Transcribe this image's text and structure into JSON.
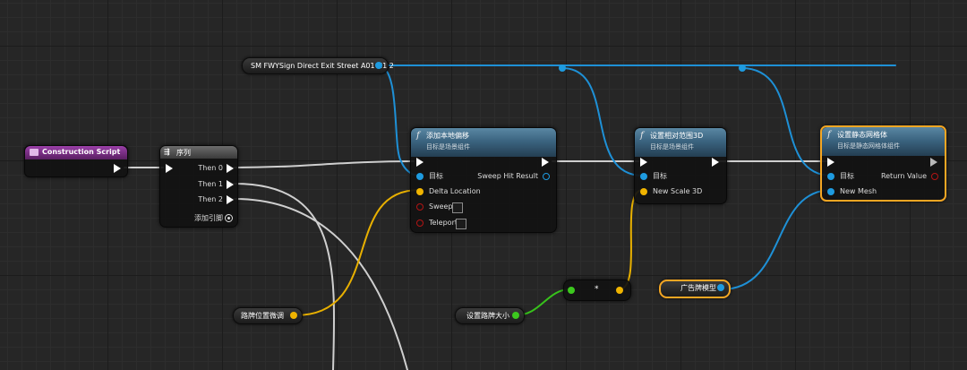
{
  "colors": {
    "exec": "#ffffff",
    "object": "#1e9be0",
    "vector": "#f0b400",
    "float": "#3cc81e",
    "struct": "#e8c020",
    "selection": "#f4a623",
    "function_header": "#3b6480",
    "event_header": "#7a2f86"
  },
  "variables": {
    "sm_mesh": "SM FWYSign Direct Exit Street A01 N1 2",
    "sign_offset": "路牌位置微调",
    "sign_size": "设置路牌大小",
    "billboard_model": "广告牌模型"
  },
  "construction_script": {
    "title": "Construction Script"
  },
  "sequence": {
    "title": "序列",
    "then0": "Then 0",
    "then1": "Then 1",
    "then2": "Then 2",
    "add_pin": "添加引脚"
  },
  "add_local_offset": {
    "title": "添加本地偏移",
    "subtitle": "目标是场景组件",
    "target": "目标",
    "delta": "Delta Location",
    "sweep": "Sweep",
    "teleport": "Teleport",
    "sweep_hit": "Sweep Hit Result"
  },
  "set_relative_scale": {
    "title": "设置相对范围3D",
    "subtitle": "目标是场景组件",
    "target": "目标",
    "new_scale": "New Scale 3D"
  },
  "set_static_mesh": {
    "title": "设置静态网格体",
    "subtitle": "目标是静态网格体组件",
    "target": "目标",
    "new_mesh": "New Mesh",
    "return_value": "Return Value"
  },
  "multiply": {
    "symbol": "*"
  },
  "icons": {
    "function": "function-icon",
    "event": "event-icon",
    "sequence": "sequence-icon",
    "add_pin": "add-pin-icon"
  }
}
